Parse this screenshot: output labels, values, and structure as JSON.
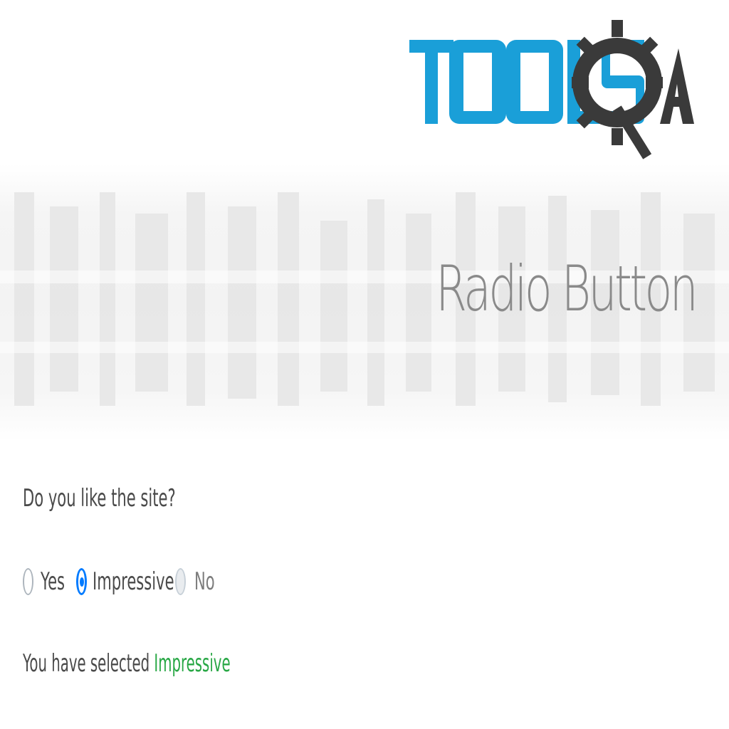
{
  "logo": {
    "text_tools": "TOOLS",
    "text_qa": "QA",
    "colors": {
      "tools": "#1a9fd8",
      "qa": "#3a3a3a"
    }
  },
  "page": {
    "title": "Radio Button"
  },
  "form": {
    "question": "Do you like the site?",
    "options": [
      {
        "label": "Yes",
        "checked": false,
        "disabled": false
      },
      {
        "label": "Impressive",
        "checked": true,
        "disabled": false
      },
      {
        "label": "No",
        "checked": false,
        "disabled": true
      }
    ],
    "result_prefix": "You have selected",
    "result_value": "Impressive"
  },
  "colors": {
    "accent": "#007bff",
    "success": "#28a745",
    "text": "#4a4a4a"
  }
}
